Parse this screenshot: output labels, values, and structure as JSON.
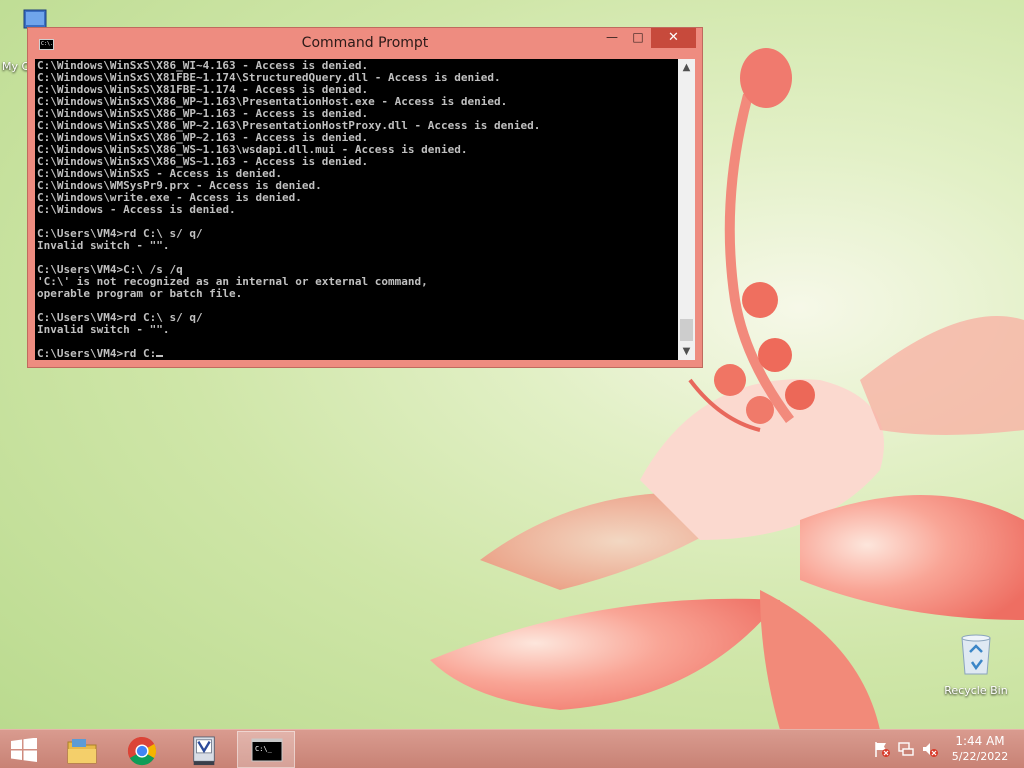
{
  "desktop": {
    "icons": [
      {
        "label": "My C",
        "icon": "my-computer-icon"
      },
      {
        "label": "Recycle Bin",
        "icon": "recycle-bin-icon"
      }
    ]
  },
  "window": {
    "title": "Command Prompt",
    "icon_text": "C:\\.",
    "minimize": "—",
    "maximize": "□",
    "close": "✕",
    "console_lines": [
      "C:\\Windows\\WinSxS\\X86_WI~4.163 - Access is denied.",
      "C:\\Windows\\WinSxS\\X81FBE~1.174\\StructuredQuery.dll - Access is denied.",
      "C:\\Windows\\WinSxS\\X81FBE~1.174 - Access is denied.",
      "C:\\Windows\\WinSxS\\X86_WP~1.163\\PresentationHost.exe - Access is denied.",
      "C:\\Windows\\WinSxS\\X86_WP~1.163 - Access is denied.",
      "C:\\Windows\\WinSxS\\X86_WP~2.163\\PresentationHostProxy.dll - Access is denied.",
      "C:\\Windows\\WinSxS\\X86_WP~2.163 - Access is denied.",
      "C:\\Windows\\WinSxS\\X86_WS~1.163\\wsdapi.dll.mui - Access is denied.",
      "C:\\Windows\\WinSxS\\X86_WS~1.163 - Access is denied.",
      "C:\\Windows\\WinSxS - Access is denied.",
      "C:\\Windows\\WMSysPr9.prx - Access is denied.",
      "C:\\Windows\\write.exe - Access is denied.",
      "C:\\Windows - Access is denied.",
      "",
      "C:\\Users\\VM4>rd C:\\ s/ q/",
      "Invalid switch - \"\".",
      "",
      "C:\\Users\\VM4>C:\\ /s /q",
      "'C:\\' is not recognized as an internal or external command,",
      "operable program or batch file.",
      "",
      "C:\\Users\\VM4>rd C:\\ s/ q/",
      "Invalid switch - \"\".",
      ""
    ],
    "current_input": "C:\\Users\\VM4>rd C:"
  },
  "taskbar": {
    "start_icon": "windows-start-icon",
    "apps": [
      {
        "name": "file-explorer",
        "icon": "folder-icon",
        "active": false
      },
      {
        "name": "chrome",
        "icon": "chrome-icon",
        "active": false
      },
      {
        "name": "app-v",
        "icon": "app-v-icon",
        "active": false
      },
      {
        "name": "command-prompt",
        "icon": "cmd-icon",
        "active": true
      }
    ],
    "tray_icons": [
      "action-center-flag-icon",
      "network-icon",
      "volume-muted-icon"
    ],
    "time": "1:44 AM",
    "date": "5/22/2022"
  }
}
